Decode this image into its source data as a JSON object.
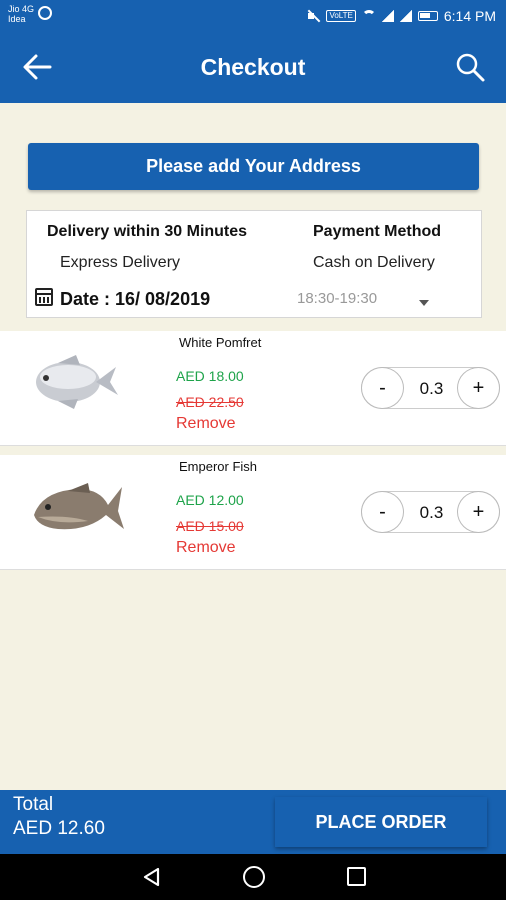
{
  "status_bar": {
    "carrier_line1": "Jio 4G",
    "carrier_line2": "Idea",
    "volte": "VoLTE",
    "time": "6:14 PM"
  },
  "app_bar": {
    "title": "Checkout",
    "back_icon": "arrow-back-icon",
    "search_icon": "search-icon"
  },
  "address_button": "Please add Your Address",
  "delivery": {
    "title_left": "Delivery within 30 Minutes",
    "title_right": "Payment Method",
    "delivery_type": "Express Delivery",
    "payment_method": "Cash on Delivery",
    "date_label": "Date : 16/ 08/2019",
    "time_slot": "18:30-19:30"
  },
  "products": [
    {
      "name": "White Pomfret",
      "price": "AED 18.00",
      "old_price": "AED 22.50",
      "remove": "Remove",
      "quantity": "0.3"
    },
    {
      "name": "Emperor Fish",
      "price": "AED 12.00",
      "old_price": "AED 15.00",
      "remove": "Remove",
      "quantity": "0.3"
    }
  ],
  "stepper": {
    "minus": "-",
    "plus": "+"
  },
  "footer": {
    "total_label": "Total",
    "total_value": "AED 12.60",
    "place_order": "PLACE ORDER"
  },
  "colors": {
    "primary": "#1761b0",
    "background": "#f4f2e3",
    "price_green": "#1ea34a",
    "alert_red": "#e53935"
  }
}
